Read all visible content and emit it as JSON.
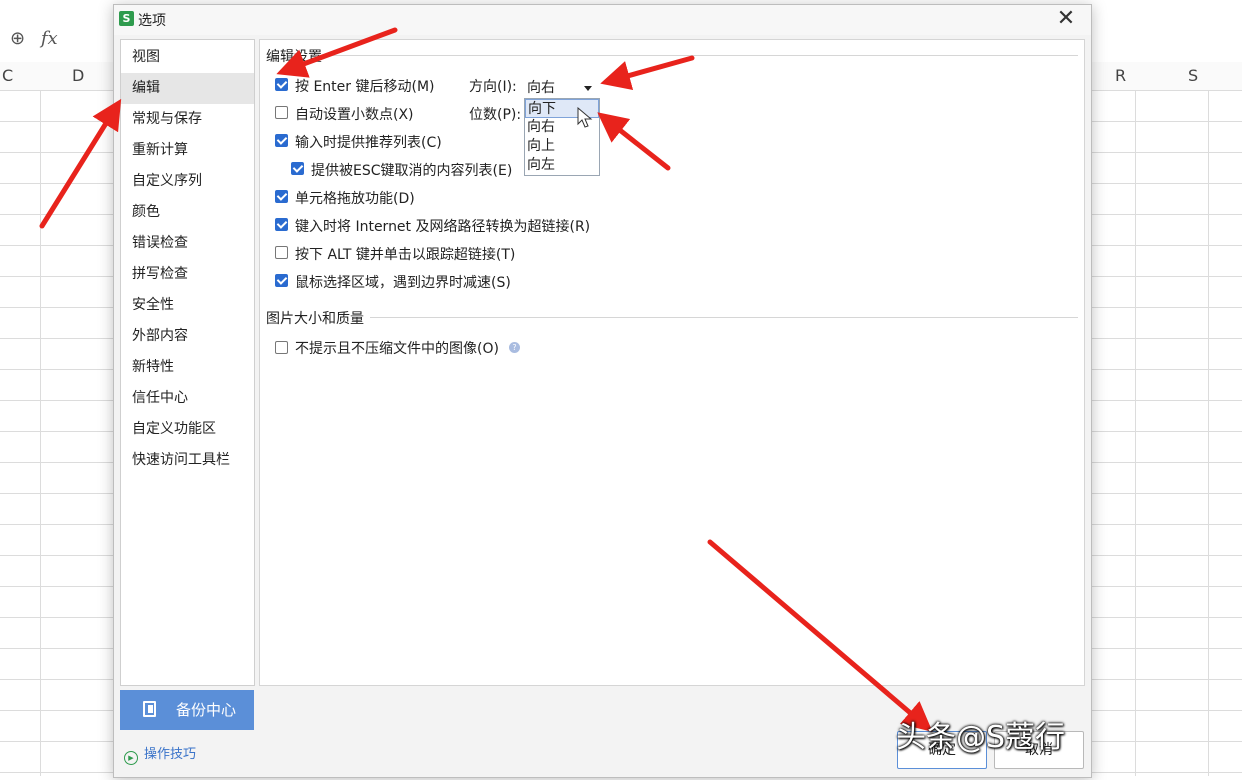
{
  "sheet": {
    "columns_left": [
      "C",
      "D"
    ],
    "columns_right": [
      "R",
      "S"
    ],
    "fx_label": "fx"
  },
  "dialog": {
    "app_icon": "S",
    "title": "选项",
    "close_glyph": "✕"
  },
  "sidebar": {
    "items": [
      {
        "label": "视图",
        "active": false
      },
      {
        "label": "编辑",
        "active": true
      },
      {
        "label": "常规与保存",
        "active": false
      },
      {
        "label": "重新计算",
        "active": false
      },
      {
        "label": "自定义序列",
        "active": false
      },
      {
        "label": "颜色",
        "active": false
      },
      {
        "label": "错误检查",
        "active": false
      },
      {
        "label": "拼写检查",
        "active": false
      },
      {
        "label": "安全性",
        "active": false
      },
      {
        "label": "外部内容",
        "active": false
      },
      {
        "label": "新特性",
        "active": false
      },
      {
        "label": "信任中心",
        "active": false
      },
      {
        "label": "自定义功能区",
        "active": false
      },
      {
        "label": "快速访问工具栏",
        "active": false
      }
    ],
    "backup_label": "备份中心",
    "tips_label": "操作技巧"
  },
  "edit_settings": {
    "section_title": "编辑设置",
    "options": [
      {
        "label": "按 Enter 键后移动(M)",
        "checked": true
      },
      {
        "label": "自动设置小数点(X)",
        "checked": false
      },
      {
        "label": "输入时提供推荐列表(C)",
        "checked": true
      },
      {
        "label": "提供被ESC键取消的内容列表(E)",
        "checked": true
      },
      {
        "label": "单元格拖放功能(D)",
        "checked": true
      },
      {
        "label": "键入时将 Internet 及网络路径转换为超链接(R)",
        "checked": true
      },
      {
        "label": "按下 ALT 键并单击以跟踪超链接(T)",
        "checked": false
      },
      {
        "label": "鼠标选择区域，遇到边界时减速(S)",
        "checked": true
      }
    ],
    "direction_label": "方向(I):",
    "direction_value": "向右",
    "digits_label": "位数(P):",
    "direction_options": [
      "向下",
      "向右",
      "向上",
      "向左"
    ],
    "hovered_option": "向下"
  },
  "image_settings": {
    "section_title": "图片大小和质量",
    "option": {
      "label": "不提示且不压缩文件中的图像(O)",
      "checked": false
    },
    "help_glyph": "?"
  },
  "footer": {
    "ok_label": "确定",
    "cancel_label": "取消"
  },
  "watermark": "头条@S蔻行"
}
